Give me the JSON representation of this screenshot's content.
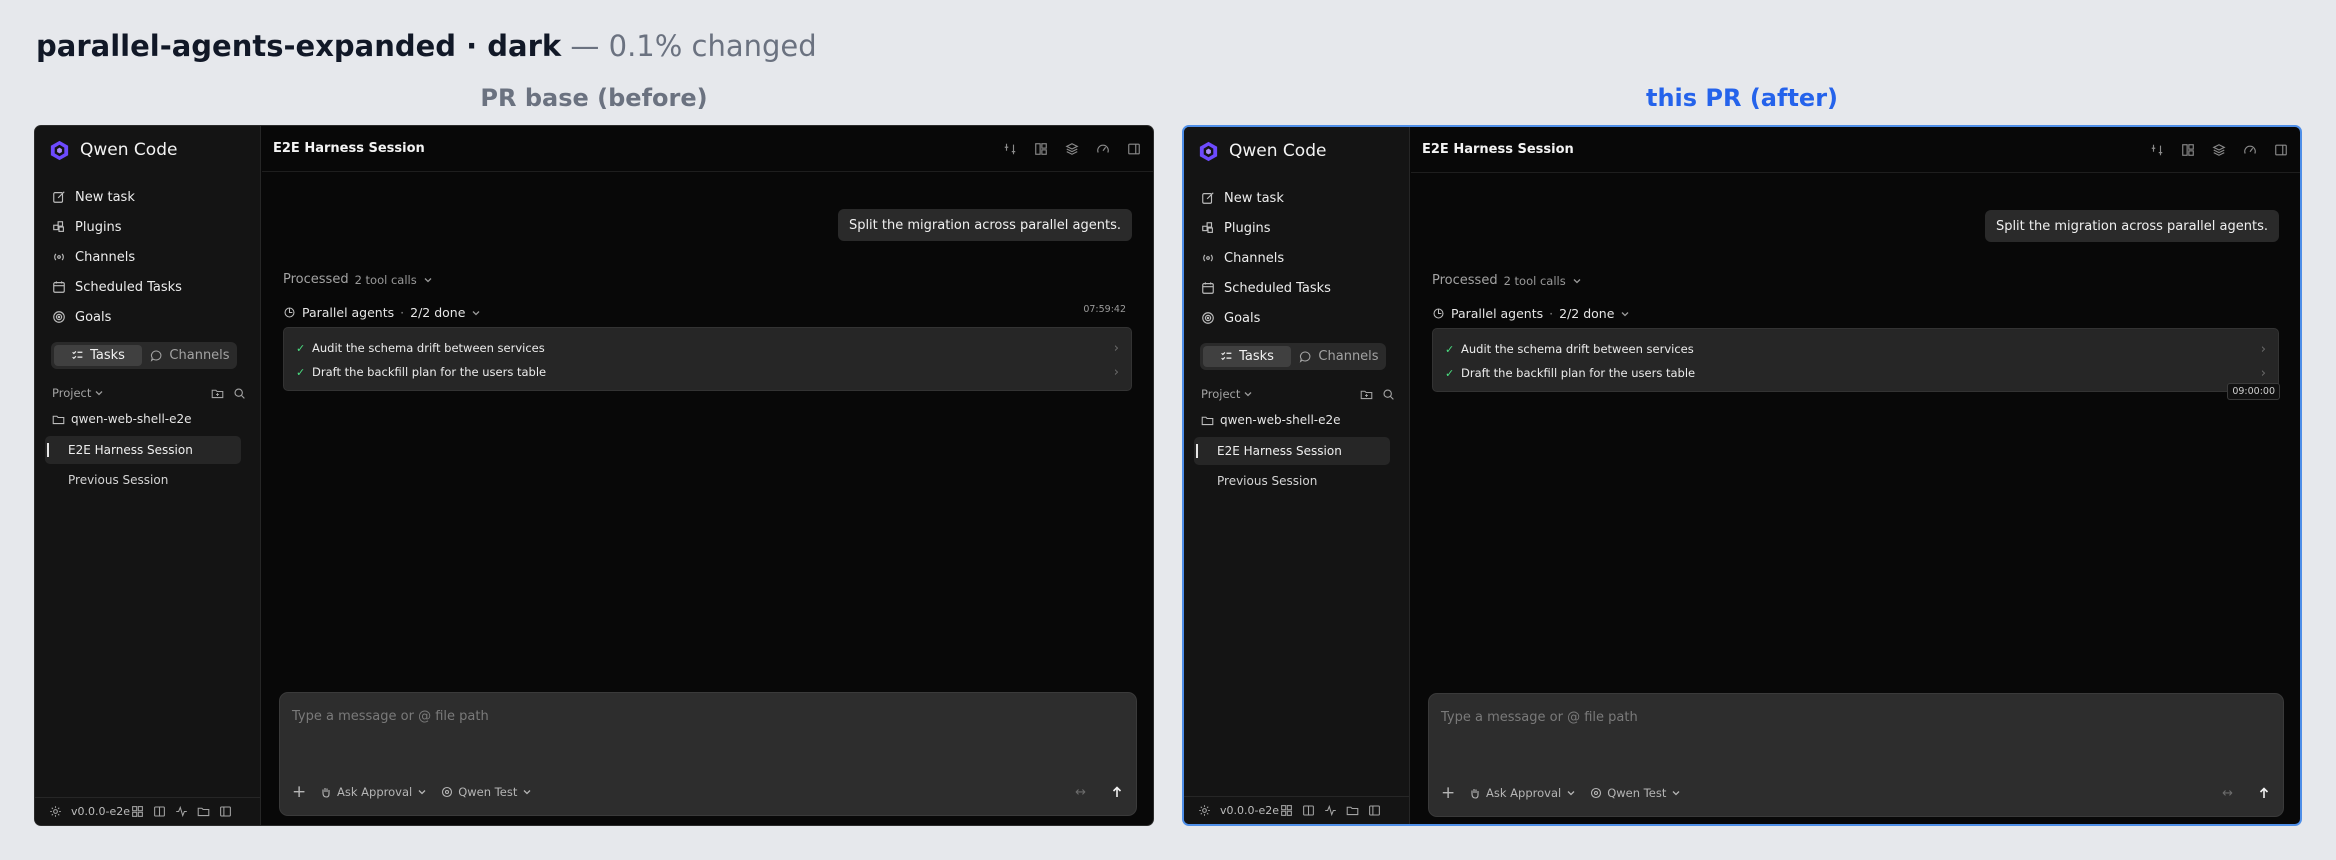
{
  "header": {
    "title": "parallel-agents-expanded · dark",
    "subtitle": "— 0.1% changed"
  },
  "panels": {
    "before_label": "PR base (before)",
    "after_label": "this PR (after)"
  },
  "app": {
    "brand": "Qwen Code",
    "nav": {
      "new_task": "New task",
      "plugins": "Plugins",
      "channels": "Channels",
      "scheduled_tasks": "Scheduled Tasks",
      "goals": "Goals"
    },
    "segment": {
      "tasks": "Tasks",
      "channels": "Channels"
    },
    "project_label": "Project",
    "folder": "qwen-web-shell-e2e",
    "sessions": [
      "E2E Harness Session",
      "Previous Session"
    ],
    "version": "v0.0.0-e2e",
    "session_title": "E2E Harness Session",
    "user_message": "Split the migration across parallel agents.",
    "processed": {
      "label": "Processed",
      "calls": "2 tool calls"
    },
    "agents": {
      "label": "Parallel agents",
      "separator": "·",
      "status": "2/2 done",
      "items": [
        "Audit the schema drift between services",
        "Draft the backfill plan for the users table"
      ]
    },
    "composer": {
      "placeholder": "Type a message or @ file path",
      "approval": "Ask Approval",
      "model": "Qwen Test"
    },
    "timestamps": {
      "before": "07:59:42",
      "after": "09:00:00"
    }
  },
  "icons": [
    "qwen-logo-icon",
    "edit-icon",
    "plugins-icon",
    "channels-icon",
    "calendar-icon",
    "target-icon",
    "tasks-icon",
    "chat-bubble-icon",
    "folder-icon",
    "search-icon",
    "gear-icon",
    "check-icon",
    "chevron-right-icon",
    "chevron-down-icon",
    "send-arrow-icon",
    "expand-icon",
    "plus-icon"
  ],
  "colors": {
    "after_outline": "#4f8fe8",
    "after_caption": "#2563eb",
    "check": "#4ade80"
  }
}
